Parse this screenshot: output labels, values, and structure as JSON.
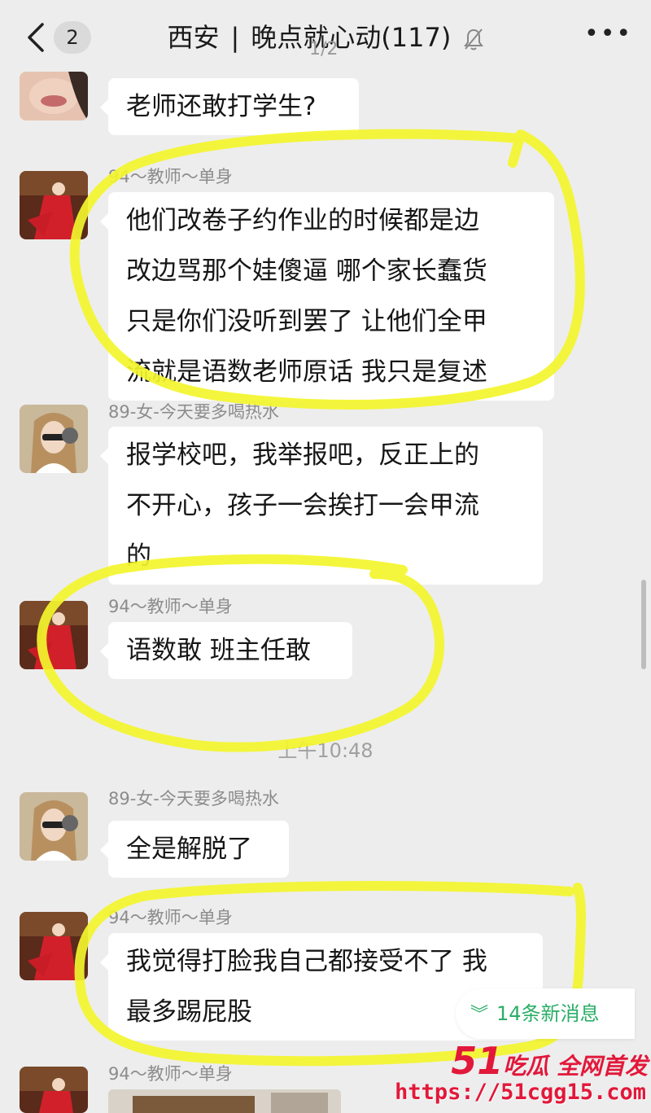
{
  "header": {
    "unread_count": "2",
    "city": "西安",
    "separator": "|",
    "group_name": "晚点就心动(117)",
    "page_indicator": "1/2",
    "more_label": "•••"
  },
  "messages": [
    {
      "sender": "",
      "text": "老师还敢打学生?"
    },
    {
      "sender": "94～教师～单身",
      "text": [
        "他们改卷子约作业的时候都是边",
        "改边骂那个娃傻逼 哪个家长蠢货",
        "只是你们没听到罢了 让他们全甲",
        "流就是语数老师原话 我只是复述"
      ]
    },
    {
      "sender": "89-女-今天要多喝热水",
      "text": [
        "报学校吧，我举报吧，反正上的",
        "不开心，孩子一会挨打一会甲流",
        "的"
      ]
    },
    {
      "sender": "94～教师～单身",
      "text": "语数敢 班主任敢"
    },
    {
      "sender": "89-女-今天要多喝热水",
      "text": "全是解脱了"
    },
    {
      "sender": "94～教师～单身",
      "text": [
        "我觉得打脸我自己都接受不了 我",
        "最多踢屁股"
      ]
    },
    {
      "sender": "94～教师～单身",
      "text": ""
    }
  ],
  "timestamp": "上午10:48",
  "new_messages": {
    "icon": "double-chevron-down-icon",
    "label": "14条新消息"
  },
  "watermark": {
    "brand_number": "51",
    "brand_text": "吃瓜 全网首发",
    "url": "https://51cgg15.com"
  },
  "colors": {
    "background": "#ededed",
    "bubble": "#ffffff",
    "highlight": "#f3f52c",
    "new_msg_green": "#2aae67",
    "watermark_red": "#e2183a"
  }
}
